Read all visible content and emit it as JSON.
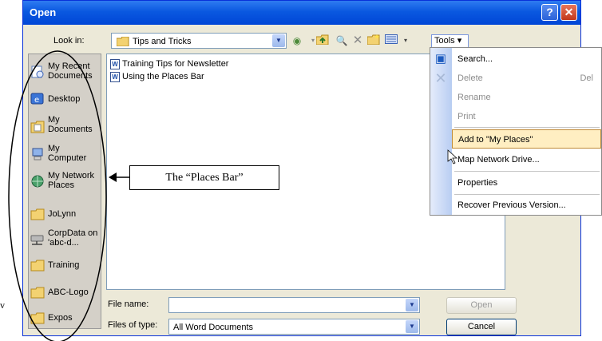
{
  "window": {
    "title": "Open",
    "help_glyph": "?",
    "close_glyph": "✕"
  },
  "lookin": {
    "label": "Look in:",
    "value": "Tips and Tricks"
  },
  "toolbar": {
    "tools_label": "Tools",
    "tools_arrow": "▾"
  },
  "places": [
    {
      "label": "My Recent Documents",
      "icon": "recent-documents-icon"
    },
    {
      "label": "Desktop",
      "icon": "desktop-icon"
    },
    {
      "label": "My Documents",
      "icon": "my-documents-icon"
    },
    {
      "label": "My Computer",
      "icon": "my-computer-icon"
    },
    {
      "label": "My Network Places",
      "icon": "network-places-icon"
    },
    {
      "label": "JoLynn",
      "icon": "folder-icon"
    },
    {
      "label": "CorpData on 'abc-d...",
      "icon": "network-drive-icon"
    },
    {
      "label": "Training",
      "icon": "folder-icon"
    },
    {
      "label": "ABC-Logo",
      "icon": "folder-icon"
    },
    {
      "label": "Expos",
      "icon": "folder-icon"
    }
  ],
  "files": [
    {
      "name": "Training Tips for Newsletter",
      "icon": "word-doc-icon",
      "glyph": "W"
    },
    {
      "name": "Using the Places Bar",
      "icon": "word-doc-icon",
      "glyph": "W"
    }
  ],
  "filename": {
    "label": "File name:",
    "value": ""
  },
  "filetype": {
    "label": "Files of type:",
    "value": "All Word Documents"
  },
  "buttons": {
    "open": "Open",
    "cancel": "Cancel"
  },
  "tools_menu": {
    "search": "Search...",
    "delete": "Delete",
    "delete_shortcut": "Del",
    "rename": "Rename",
    "print": "Print",
    "add_to_places": "Add to \"My Places\"",
    "map_drive": "Map Network Drive...",
    "properties": "Properties",
    "recover": "Recover Previous Version..."
  },
  "annotation": {
    "text": "The “Places Bar”",
    "stray": "v"
  },
  "colors": {
    "title_blue": "#0046d6",
    "places_bar": "#d4d0c8",
    "menu_highlight": "#ffeec2"
  }
}
